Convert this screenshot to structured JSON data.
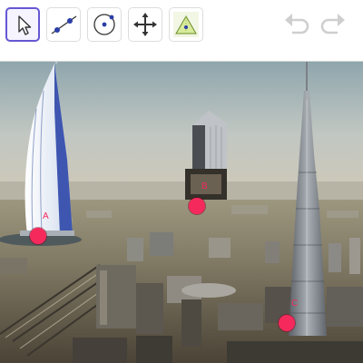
{
  "toolbar": {
    "tools": [
      {
        "name": "move-tool",
        "icon": "pointer-arrow-icon",
        "selected": true
      },
      {
        "name": "line-tool",
        "icon": "line-through-two-points-icon",
        "selected": false
      },
      {
        "name": "circle-tool",
        "icon": "circle-with-center-icon",
        "selected": false
      },
      {
        "name": "move-graphics-tool",
        "icon": "four-way-arrow-icon",
        "selected": false
      },
      {
        "name": "triangle-tool",
        "icon": "triangle-icon",
        "selected": false
      }
    ],
    "undo_icon": "undo-icon",
    "redo_icon": "redo-icon"
  },
  "canvas": {
    "background": "photo-dubai-skyline",
    "points": [
      {
        "label": "A"
      },
      {
        "label": "B"
      },
      {
        "label": "C"
      }
    ]
  },
  "colors": {
    "selection_accent": "#6557d2",
    "point_fill": "#f6295c",
    "icon_disabled": "#cfcfcf"
  }
}
